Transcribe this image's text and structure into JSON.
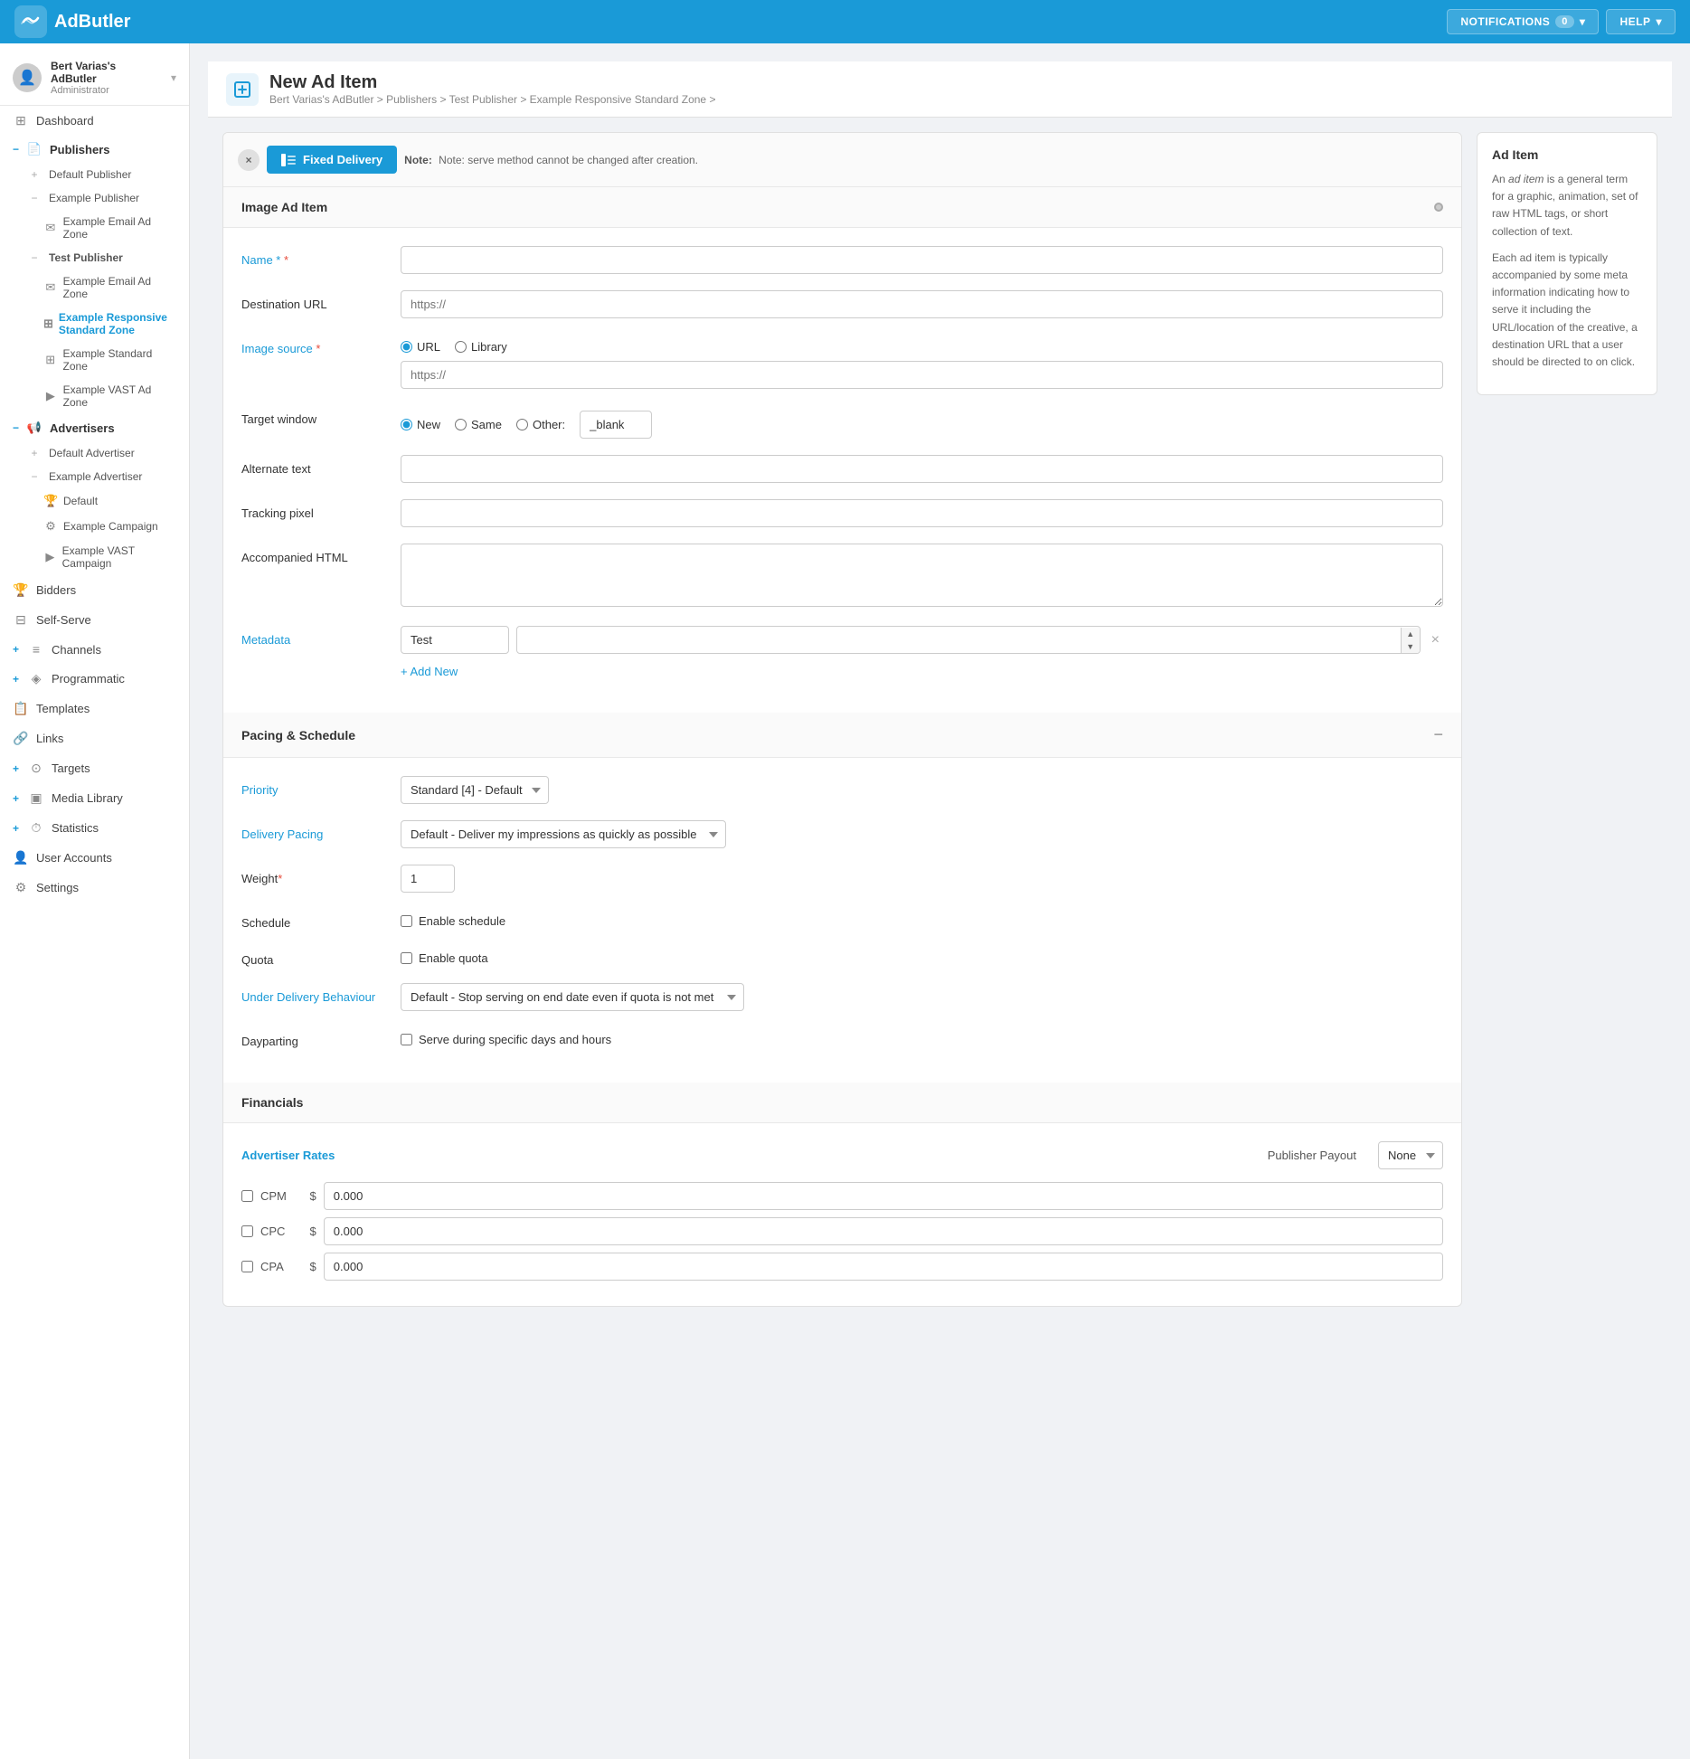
{
  "app": {
    "name": "AdButler",
    "logo_symbol": "🐟"
  },
  "navbar": {
    "notifications_label": "NOTIFICATIONS",
    "notifications_count": "0",
    "help_label": "HELP"
  },
  "user": {
    "name": "Bert Varias's AdButler",
    "role": "Administrator"
  },
  "sidebar": {
    "dashboard_label": "Dashboard",
    "publishers_label": "Publishers",
    "default_publisher_label": "Default Publisher",
    "example_publisher_label": "Example Publisher",
    "example_email_ad_zone_1_label": "Example Email Ad Zone",
    "test_publisher_label": "Test Publisher",
    "test_email_ad_zone_label": "Example Email Ad Zone",
    "example_responsive_standard_zone_label": "Example Responsive Standard Zone",
    "example_standard_zone_label": "Example Standard Zone",
    "example_vast_ad_zone_label": "Example VAST Ad Zone",
    "advertisers_label": "Advertisers",
    "default_advertiser_label": "Default Advertiser",
    "example_advertiser_label": "Example Advertiser",
    "default_label": "Default",
    "example_campaign_label": "Example Campaign",
    "example_vast_campaign_label": "Example VAST Campaign",
    "bidders_label": "Bidders",
    "self_serve_label": "Self-Serve",
    "channels_label": "Channels",
    "programmatic_label": "Programmatic",
    "templates_label": "Templates",
    "links_label": "Links",
    "targets_label": "Targets",
    "media_library_label": "Media Library",
    "statistics_label": "Statistics",
    "user_accounts_label": "User Accounts",
    "settings_label": "Settings"
  },
  "page": {
    "title": "New Ad Item",
    "breadcrumb": "Bert Varias's AdButler > Publishers > Test Publisher > Example Responsive Standard Zone >"
  },
  "serve_method": {
    "close_label": "×",
    "selected_label": "Fixed Delivery",
    "note": "Note: serve method cannot be changed after creation."
  },
  "image_ad_item": {
    "section_title": "Image Ad Item",
    "name_label": "Name",
    "destination_url_label": "Destination URL",
    "destination_url_placeholder": "https://",
    "image_source_label": "Image source",
    "image_source_url_label": "URL",
    "image_source_library_label": "Library",
    "image_url_placeholder": "https://",
    "target_window_label": "Target window",
    "target_window_new_label": "New",
    "target_window_same_label": "Same",
    "target_window_other_label": "Other:",
    "target_window_other_value": "_blank",
    "alternate_text_label": "Alternate text",
    "tracking_pixel_label": "Tracking pixel",
    "accompanied_html_label": "Accompanied HTML",
    "metadata_label": "Metadata",
    "metadata_key_value": "Test",
    "metadata_value_value": "",
    "add_new_label": "+ Add New"
  },
  "pacing_schedule": {
    "section_title": "Pacing & Schedule",
    "priority_label": "Priority",
    "priority_options": [
      "Standard [4] - Default"
    ],
    "priority_selected": "Standard [4] - Default",
    "delivery_pacing_label": "Delivery Pacing",
    "delivery_pacing_options": [
      "Default - Deliver my impressions as quickly as possible"
    ],
    "delivery_pacing_selected": "Default - Deliver my impressions as quickly as possible",
    "weight_label": "Weight",
    "weight_value": "1",
    "schedule_label": "Schedule",
    "schedule_checkbox_label": "Enable schedule",
    "quota_label": "Quota",
    "quota_checkbox_label": "Enable quota",
    "under_delivery_label": "Under Delivery Behaviour",
    "under_delivery_options": [
      "Default - Stop serving on end date even if quota is not met"
    ],
    "under_delivery_selected": "Default - Stop serving on end date even if quota is not met",
    "dayparting_label": "Dayparting",
    "dayparting_checkbox_label": "Serve during specific days and hours"
  },
  "financials": {
    "section_title": "Financials",
    "advertiser_rates_label": "Advertiser Rates",
    "publisher_payout_label": "Publisher Payout",
    "publisher_payout_options": [
      "None"
    ],
    "publisher_payout_selected": "None",
    "cpm_label": "CPM",
    "cpc_label": "CPC",
    "cpa_label": "CPA",
    "dollar_sign": "$",
    "cpm_value": "0.000",
    "cpc_value": "0.000",
    "cpa_value": "0.000"
  },
  "info_panel": {
    "title": "Ad Item",
    "paragraph1": "An ad item is a general term for a graphic, animation, set of raw HTML tags, or short collection of text.",
    "paragraph2": "Each ad item is typically accompanied by some meta information indicating how to serve it including the URL/location of the creative, a destination URL that a user should be directed to on click."
  }
}
